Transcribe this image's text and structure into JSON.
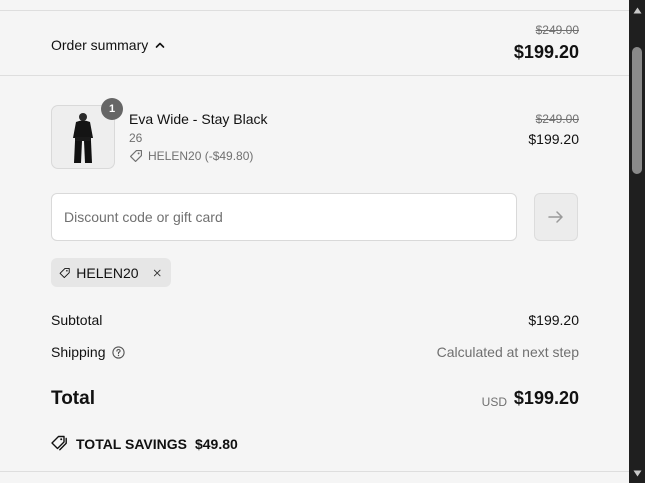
{
  "summary": {
    "toggle_label": "Order summary",
    "compare_at_price": "$249.00",
    "total_price": "$199.20"
  },
  "product": {
    "quantity": "1",
    "name": "Eva Wide - Stay Black",
    "variant": "26",
    "discount_line": "HELEN20 (-$49.80)",
    "compare_at_price": "$249.00",
    "price": "$199.20"
  },
  "discount": {
    "placeholder": "Discount code or gift card",
    "value": "",
    "apply_icon": "arrow-right-icon",
    "applied_code": "HELEN20"
  },
  "totals": {
    "subtotal_label": "Subtotal",
    "subtotal_value": "$199.20",
    "shipping_label": "Shipping",
    "shipping_value": "Calculated at next step",
    "total_label": "Total",
    "currency": "USD",
    "total_value": "$199.20",
    "savings_label": "TOTAL SAVINGS",
    "savings_value": "$49.80"
  },
  "colors": {
    "panel_bg": "#f5f5f5",
    "text_primary": "#111111",
    "text_secondary": "#707070",
    "badge_bg": "#666666",
    "tag_bg": "#e6e6e6",
    "scrollbar_bg": "#1f1f1f"
  }
}
